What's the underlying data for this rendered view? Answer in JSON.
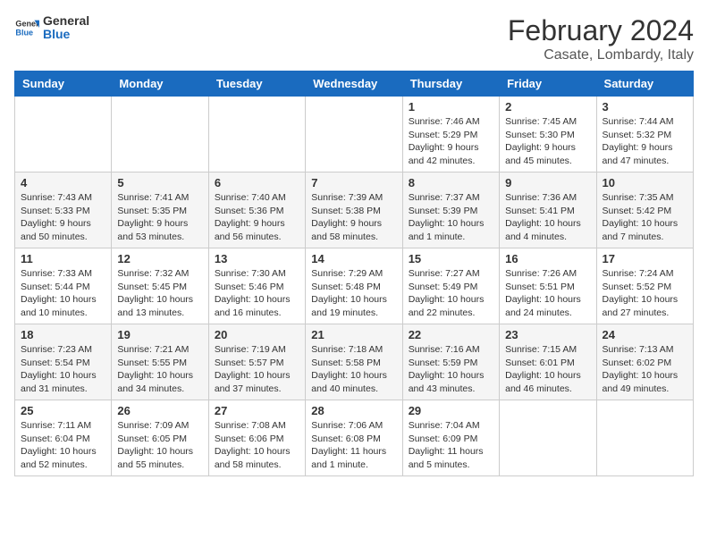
{
  "header": {
    "logo_line1": "General",
    "logo_line2": "Blue",
    "title": "February 2024",
    "subtitle": "Casate, Lombardy, Italy"
  },
  "weekdays": [
    "Sunday",
    "Monday",
    "Tuesday",
    "Wednesday",
    "Thursday",
    "Friday",
    "Saturday"
  ],
  "weeks": [
    [
      {
        "day": "",
        "info": ""
      },
      {
        "day": "",
        "info": ""
      },
      {
        "day": "",
        "info": ""
      },
      {
        "day": "",
        "info": ""
      },
      {
        "day": "1",
        "info": "Sunrise: 7:46 AM\nSunset: 5:29 PM\nDaylight: 9 hours\nand 42 minutes."
      },
      {
        "day": "2",
        "info": "Sunrise: 7:45 AM\nSunset: 5:30 PM\nDaylight: 9 hours\nand 45 minutes."
      },
      {
        "day": "3",
        "info": "Sunrise: 7:44 AM\nSunset: 5:32 PM\nDaylight: 9 hours\nand 47 minutes."
      }
    ],
    [
      {
        "day": "4",
        "info": "Sunrise: 7:43 AM\nSunset: 5:33 PM\nDaylight: 9 hours\nand 50 minutes."
      },
      {
        "day": "5",
        "info": "Sunrise: 7:41 AM\nSunset: 5:35 PM\nDaylight: 9 hours\nand 53 minutes."
      },
      {
        "day": "6",
        "info": "Sunrise: 7:40 AM\nSunset: 5:36 PM\nDaylight: 9 hours\nand 56 minutes."
      },
      {
        "day": "7",
        "info": "Sunrise: 7:39 AM\nSunset: 5:38 PM\nDaylight: 9 hours\nand 58 minutes."
      },
      {
        "day": "8",
        "info": "Sunrise: 7:37 AM\nSunset: 5:39 PM\nDaylight: 10 hours\nand 1 minute."
      },
      {
        "day": "9",
        "info": "Sunrise: 7:36 AM\nSunset: 5:41 PM\nDaylight: 10 hours\nand 4 minutes."
      },
      {
        "day": "10",
        "info": "Sunrise: 7:35 AM\nSunset: 5:42 PM\nDaylight: 10 hours\nand 7 minutes."
      }
    ],
    [
      {
        "day": "11",
        "info": "Sunrise: 7:33 AM\nSunset: 5:44 PM\nDaylight: 10 hours\nand 10 minutes."
      },
      {
        "day": "12",
        "info": "Sunrise: 7:32 AM\nSunset: 5:45 PM\nDaylight: 10 hours\nand 13 minutes."
      },
      {
        "day": "13",
        "info": "Sunrise: 7:30 AM\nSunset: 5:46 PM\nDaylight: 10 hours\nand 16 minutes."
      },
      {
        "day": "14",
        "info": "Sunrise: 7:29 AM\nSunset: 5:48 PM\nDaylight: 10 hours\nand 19 minutes."
      },
      {
        "day": "15",
        "info": "Sunrise: 7:27 AM\nSunset: 5:49 PM\nDaylight: 10 hours\nand 22 minutes."
      },
      {
        "day": "16",
        "info": "Sunrise: 7:26 AM\nSunset: 5:51 PM\nDaylight: 10 hours\nand 24 minutes."
      },
      {
        "day": "17",
        "info": "Sunrise: 7:24 AM\nSunset: 5:52 PM\nDaylight: 10 hours\nand 27 minutes."
      }
    ],
    [
      {
        "day": "18",
        "info": "Sunrise: 7:23 AM\nSunset: 5:54 PM\nDaylight: 10 hours\nand 31 minutes."
      },
      {
        "day": "19",
        "info": "Sunrise: 7:21 AM\nSunset: 5:55 PM\nDaylight: 10 hours\nand 34 minutes."
      },
      {
        "day": "20",
        "info": "Sunrise: 7:19 AM\nSunset: 5:57 PM\nDaylight: 10 hours\nand 37 minutes."
      },
      {
        "day": "21",
        "info": "Sunrise: 7:18 AM\nSunset: 5:58 PM\nDaylight: 10 hours\nand 40 minutes."
      },
      {
        "day": "22",
        "info": "Sunrise: 7:16 AM\nSunset: 5:59 PM\nDaylight: 10 hours\nand 43 minutes."
      },
      {
        "day": "23",
        "info": "Sunrise: 7:15 AM\nSunset: 6:01 PM\nDaylight: 10 hours\nand 46 minutes."
      },
      {
        "day": "24",
        "info": "Sunrise: 7:13 AM\nSunset: 6:02 PM\nDaylight: 10 hours\nand 49 minutes."
      }
    ],
    [
      {
        "day": "25",
        "info": "Sunrise: 7:11 AM\nSunset: 6:04 PM\nDaylight: 10 hours\nand 52 minutes."
      },
      {
        "day": "26",
        "info": "Sunrise: 7:09 AM\nSunset: 6:05 PM\nDaylight: 10 hours\nand 55 minutes."
      },
      {
        "day": "27",
        "info": "Sunrise: 7:08 AM\nSunset: 6:06 PM\nDaylight: 10 hours\nand 58 minutes."
      },
      {
        "day": "28",
        "info": "Sunrise: 7:06 AM\nSunset: 6:08 PM\nDaylight: 11 hours\nand 1 minute."
      },
      {
        "day": "29",
        "info": "Sunrise: 7:04 AM\nSunset: 6:09 PM\nDaylight: 11 hours\nand 5 minutes."
      },
      {
        "day": "",
        "info": ""
      },
      {
        "day": "",
        "info": ""
      }
    ]
  ]
}
